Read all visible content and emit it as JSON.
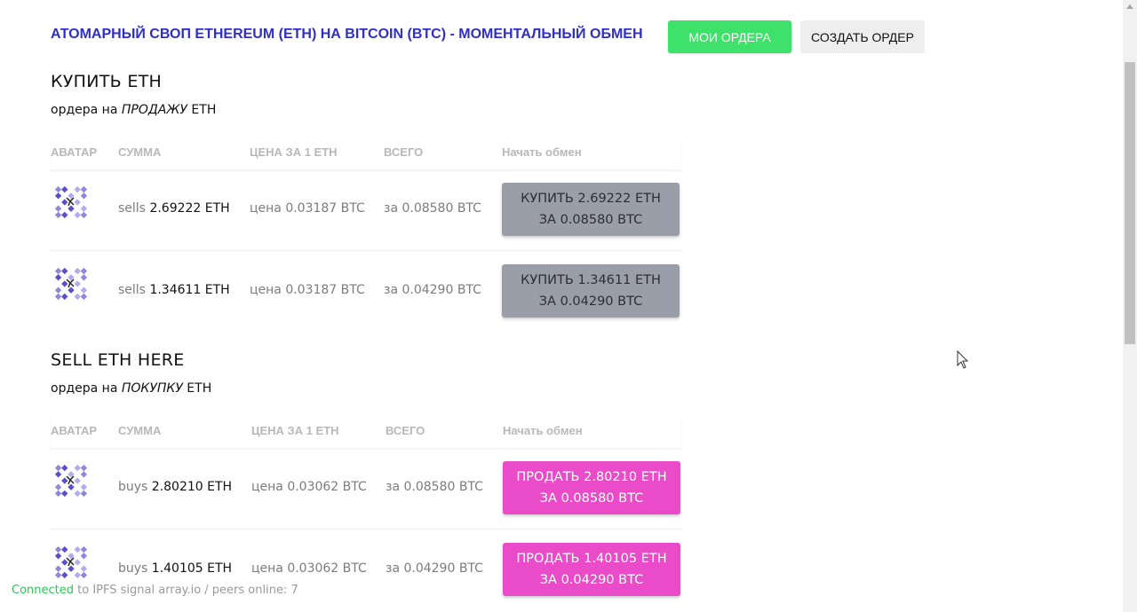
{
  "header": {
    "title": "АТОМАРНЫЙ СВОП ETHEREUM (ETH) НА BITCOIN (BTC) - МОМЕНТАЛЬНЫЙ ОБМЕН",
    "my_orders_label": "МОИ ОРДЕРА",
    "create_order_label": "СОЗДАТЬ ОРДЕР"
  },
  "buy_section": {
    "heading": "КУПИТЬ ETH",
    "sub_prefix": "ордера на ",
    "sub_em": "ПРОДАЖУ",
    "sub_suffix": " ETH",
    "columns": {
      "avatar": "АВАТАР",
      "amount": "СУММА",
      "price": "ЦЕНА ЗА 1 ETH",
      "total": "ВСЕГО",
      "start": "Начать обмен"
    },
    "rows": [
      {
        "side": "sells",
        "amount": "2.69222 ETH",
        "price": "цена 0.03187 BTC",
        "total": "за 0.08580 BTC",
        "action_line1": "КУПИТЬ 2.69222 ETH",
        "action_line2": "ЗА 0.08580 BTC"
      },
      {
        "side": "sells",
        "amount": "1.34611 ETH",
        "price": "цена 0.03187 BTC",
        "total": "за 0.04290 BTC",
        "action_line1": "КУПИТЬ 1.34611 ETH",
        "action_line2": "ЗА 0.04290 BTC"
      }
    ]
  },
  "sell_section": {
    "heading": "SELL ETH HERE",
    "sub_prefix": "ордера на ",
    "sub_em": "ПОКУПКУ",
    "sub_suffix": " ETH",
    "columns": {
      "avatar": "АВАТАР",
      "amount": "СУММА",
      "price": "ЦЕНА ЗА 1 ETH",
      "total": "ВСЕГО",
      "start": "Начать обмен"
    },
    "rows": [
      {
        "side": "buys",
        "amount": "2.80210 ETH",
        "price": "цена 0.03062 BTC",
        "total": "за 0.08580 BTC",
        "action_line1": "ПРОДАТЬ 2.80210 ETH",
        "action_line2": "ЗА 0.08580 BTC"
      },
      {
        "side": "buys",
        "amount": "1.40105 ETH",
        "price": "цена 0.03062 BTC",
        "total": "за 0.04290 BTC",
        "action_line1": "ПРОДАТЬ 1.40105 ETH",
        "action_line2": "ЗА 0.04290 BTC"
      }
    ]
  },
  "status": {
    "connected": "Connected",
    "rest": " to IPFS signal array.io / peers online: 7"
  },
  "colors": {
    "title": "#2f2fc8",
    "my_orders_bg": "#3ee16a",
    "buy_button_bg": "#9a9ea8",
    "sell_button_bg": "#e94bc9",
    "connected": "#2fc45a"
  },
  "icons": {
    "avatar": "identicon-avatar",
    "cursor": "mouse-pointer-icon"
  }
}
